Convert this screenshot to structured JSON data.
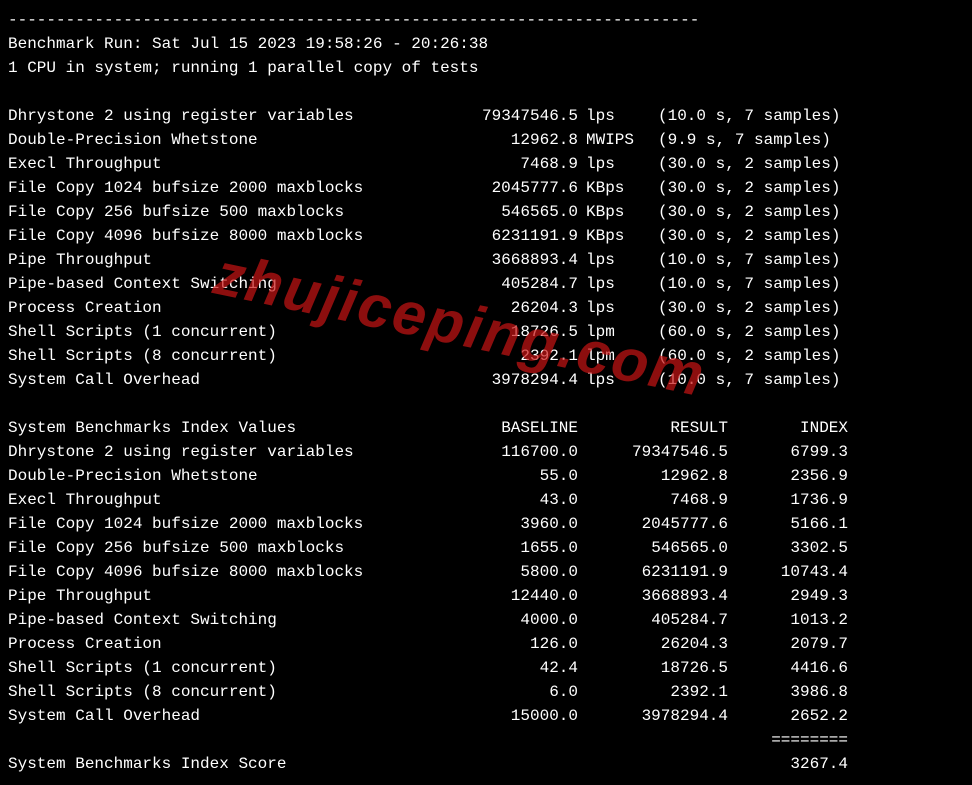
{
  "divider": "------------------------------------------------------------------------",
  "header": {
    "run_line": "Benchmark Run: Sat Jul 15 2023 19:58:26 - 20:26:38",
    "cpu_line": "1 CPU in system; running 1 parallel copy of tests"
  },
  "benchmarks": [
    {
      "name": "Dhrystone 2 using register variables",
      "value": "79347546.5",
      "unit": "lps",
      "meta": "(10.0 s, 7 samples)"
    },
    {
      "name": "Double-Precision Whetstone",
      "value": "12962.8",
      "unit": "MWIPS",
      "meta": "(9.9 s, 7 samples)"
    },
    {
      "name": "Execl Throughput",
      "value": "7468.9",
      "unit": "lps",
      "meta": "(30.0 s, 2 samples)"
    },
    {
      "name": "File Copy 1024 bufsize 2000 maxblocks",
      "value": "2045777.6",
      "unit": "KBps",
      "meta": "(30.0 s, 2 samples)"
    },
    {
      "name": "File Copy 256 bufsize 500 maxblocks",
      "value": "546565.0",
      "unit": "KBps",
      "meta": "(30.0 s, 2 samples)"
    },
    {
      "name": "File Copy 4096 bufsize 8000 maxblocks",
      "value": "6231191.9",
      "unit": "KBps",
      "meta": "(30.0 s, 2 samples)"
    },
    {
      "name": "Pipe Throughput",
      "value": "3668893.4",
      "unit": "lps",
      "meta": "(10.0 s, 7 samples)"
    },
    {
      "name": "Pipe-based Context Switching",
      "value": "405284.7",
      "unit": "lps",
      "meta": "(10.0 s, 7 samples)"
    },
    {
      "name": "Process Creation",
      "value": "26204.3",
      "unit": "lps",
      "meta": "(30.0 s, 2 samples)"
    },
    {
      "name": "Shell Scripts (1 concurrent)",
      "value": "18726.5",
      "unit": "lpm",
      "meta": "(60.0 s, 2 samples)"
    },
    {
      "name": "Shell Scripts (8 concurrent)",
      "value": "2392.1",
      "unit": "lpm",
      "meta": "(60.0 s, 2 samples)"
    },
    {
      "name": "System Call Overhead",
      "value": "3978294.4",
      "unit": "lps",
      "meta": "(10.0 s, 7 samples)"
    }
  ],
  "index_header": {
    "title": "System Benchmarks Index Values",
    "baseline": "BASELINE",
    "result": "RESULT",
    "index": "INDEX"
  },
  "indexes": [
    {
      "name": "Dhrystone 2 using register variables",
      "baseline": "116700.0",
      "result": "79347546.5",
      "index": "6799.3"
    },
    {
      "name": "Double-Precision Whetstone",
      "baseline": "55.0",
      "result": "12962.8",
      "index": "2356.9"
    },
    {
      "name": "Execl Throughput",
      "baseline": "43.0",
      "result": "7468.9",
      "index": "1736.9"
    },
    {
      "name": "File Copy 1024 bufsize 2000 maxblocks",
      "baseline": "3960.0",
      "result": "2045777.6",
      "index": "5166.1"
    },
    {
      "name": "File Copy 256 bufsize 500 maxblocks",
      "baseline": "1655.0",
      "result": "546565.0",
      "index": "3302.5"
    },
    {
      "name": "File Copy 4096 bufsize 8000 maxblocks",
      "baseline": "5800.0",
      "result": "6231191.9",
      "index": "10743.4"
    },
    {
      "name": "Pipe Throughput",
      "baseline": "12440.0",
      "result": "3668893.4",
      "index": "2949.3"
    },
    {
      "name": "Pipe-based Context Switching",
      "baseline": "4000.0",
      "result": "405284.7",
      "index": "1013.2"
    },
    {
      "name": "Process Creation",
      "baseline": "126.0",
      "result": "26204.3",
      "index": "2079.7"
    },
    {
      "name": "Shell Scripts (1 concurrent)",
      "baseline": "42.4",
      "result": "18726.5",
      "index": "4416.6"
    },
    {
      "name": "Shell Scripts (8 concurrent)",
      "baseline": "6.0",
      "result": "2392.1",
      "index": "3986.8"
    },
    {
      "name": "System Call Overhead",
      "baseline": "15000.0",
      "result": "3978294.4",
      "index": "2652.2"
    }
  ],
  "equals": "========",
  "score": {
    "label": "System Benchmarks Index Score",
    "value": "3267.4"
  },
  "watermark": "zhujiceping.com"
}
